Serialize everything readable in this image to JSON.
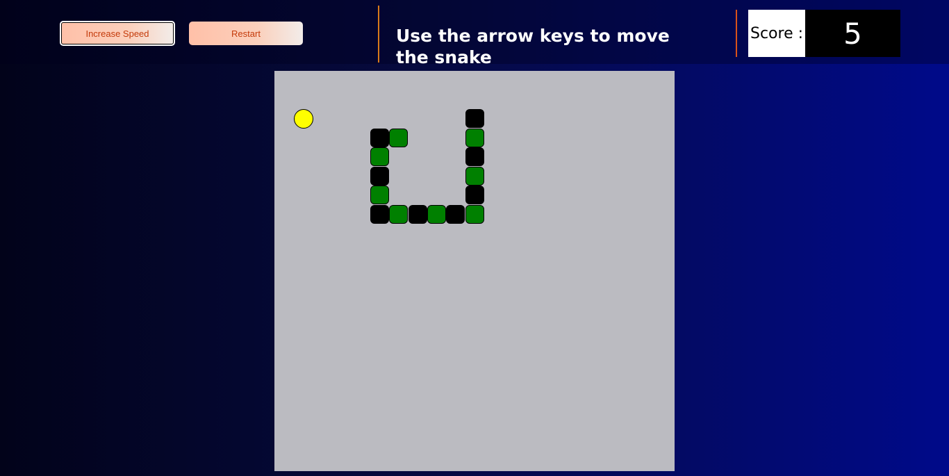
{
  "controls": {
    "increase_speed_label": "Increase Speed",
    "restart_label": "Restart"
  },
  "instructions": "Use the arrow keys to move the snake",
  "score": {
    "label": "Score :",
    "value": "5"
  },
  "colors": {
    "board": "#bbbbc1",
    "snake_dark": "#000000",
    "snake_green": "#008000",
    "food": "#ffff00"
  },
  "game": {
    "grid_cells": 21,
    "food": {
      "col": 1,
      "row": 2
    },
    "snake": [
      {
        "col": 10,
        "row": 2,
        "color": "dark"
      },
      {
        "col": 10,
        "row": 3,
        "color": "green"
      },
      {
        "col": 10,
        "row": 4,
        "color": "dark"
      },
      {
        "col": 10,
        "row": 5,
        "color": "green"
      },
      {
        "col": 10,
        "row": 6,
        "color": "dark"
      },
      {
        "col": 10,
        "row": 7,
        "color": "green"
      },
      {
        "col": 9,
        "row": 7,
        "color": "dark"
      },
      {
        "col": 8,
        "row": 7,
        "color": "green"
      },
      {
        "col": 7,
        "row": 7,
        "color": "dark"
      },
      {
        "col": 6,
        "row": 7,
        "color": "green"
      },
      {
        "col": 5,
        "row": 7,
        "color": "dark"
      },
      {
        "col": 5,
        "row": 6,
        "color": "green"
      },
      {
        "col": 5,
        "row": 5,
        "color": "dark"
      },
      {
        "col": 5,
        "row": 4,
        "color": "green"
      },
      {
        "col": 5,
        "row": 3,
        "color": "dark"
      },
      {
        "col": 6,
        "row": 3,
        "color": "green"
      }
    ]
  }
}
